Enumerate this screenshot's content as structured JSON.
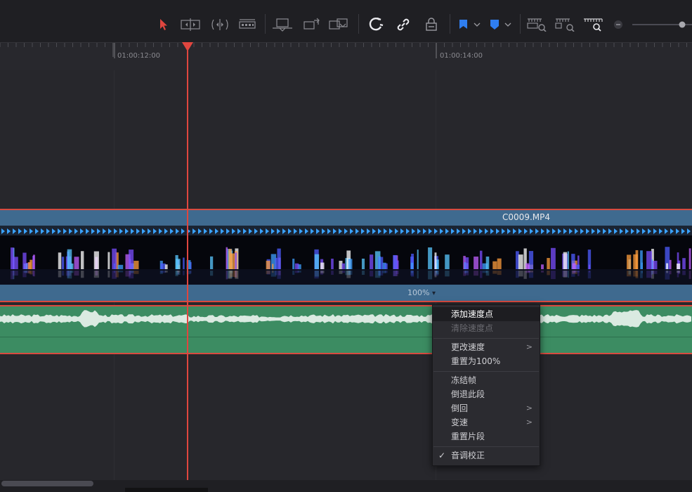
{
  "ruler": {
    "tc1": "01:00:12:00",
    "tc2": "01:00:14:00"
  },
  "clip": {
    "name": "C0009.MP4",
    "speed": "100%",
    "speed_arrow": "▾"
  },
  "context_menu": {
    "items": [
      {
        "label": "添加速度点",
        "state": "hover"
      },
      {
        "label": "清除速度点",
        "state": "disabled"
      },
      {
        "label": "更改速度",
        "submenu": ">"
      },
      {
        "label": "重置为100%"
      },
      {
        "label": "冻结帧"
      },
      {
        "label": "倒退此段"
      },
      {
        "label": "倒回",
        "submenu": ">"
      },
      {
        "label": "变速",
        "submenu": ">"
      },
      {
        "label": "重置片段"
      },
      {
        "label": "音调校正",
        "check": "✓"
      }
    ]
  },
  "toolbar_icons": [
    "selection-arrow-icon",
    "trim-mode-icon",
    "dynamic-trim-icon",
    "blade-icon",
    "insert-clip-icon",
    "overwrite-clip-icon",
    "replace-clip-icon",
    "snapping-icon",
    "linked-selection-icon",
    "position-lock-icon",
    "flag-icon",
    "marker-icon",
    "zoom-full-icon",
    "zoom-detail-icon",
    "zoom-custom-icon",
    "zoom-out-icon",
    "zoom-slider"
  ],
  "colors": {
    "playhead": "#e0463f",
    "clip_blue": "#3f6a8f",
    "audio_green": "#3c8c62",
    "flag_blue": "#2f7ef0"
  }
}
